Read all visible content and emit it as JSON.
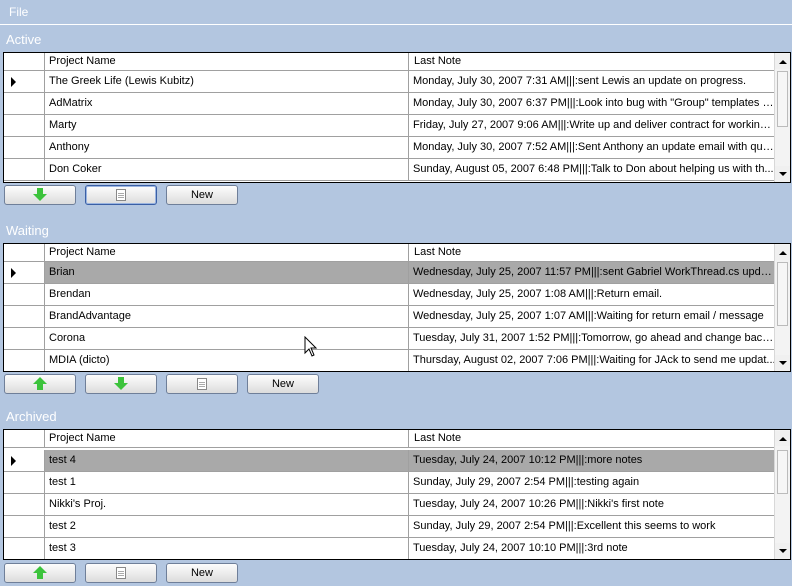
{
  "menu": {
    "file": "File"
  },
  "columns": {
    "name": "Project Name",
    "note": "Last Note"
  },
  "sections": [
    {
      "title": "Active",
      "rows": [
        {
          "name": "The Greek Life (Lewis Kubitz)",
          "note": "Monday, July 30, 2007 7:31 AM|||:sent Lewis an update on progress."
        },
        {
          "name": "AdMatrix",
          "note": "Monday, July 30, 2007 6:37 PM|||:Look into bug with \"Group\" templates o..."
        },
        {
          "name": "Marty",
          "note": "Friday, July 27, 2007 9:06 AM|||:Write up and deliver contract for working ..."
        },
        {
          "name": "Anthony",
          "note": "Monday, July 30, 2007 7:52 AM|||:Sent Anthony an update email with que..."
        },
        {
          "name": "Don Coker",
          "note": "Sunday, August 05, 2007 6:48 PM|||:Talk to Don about helping us with th..."
        }
      ],
      "buttons": {
        "new": "New"
      }
    },
    {
      "title": "Waiting",
      "rows": [
        {
          "name": "Brian",
          "note": "Wednesday, July 25, 2007 11:57 PM|||:sent Gabriel WorkThread.cs updat..."
        },
        {
          "name": "Brendan",
          "note": "Wednesday, July 25, 2007 1:08 AM|||:Return email."
        },
        {
          "name": "BrandAdvantage",
          "note": "Wednesday, July 25, 2007 1:07 AM|||:Waiting for return email / message"
        },
        {
          "name": "Corona",
          "note": "Tuesday, July 31, 2007 1:52 PM|||:Tomorrow, go ahead and change back..."
        },
        {
          "name": "MDIA (dicto)",
          "note": "Thursday, August 02, 2007 7:06 PM|||:Waiting for JAck to send me updat..."
        }
      ],
      "buttons": {
        "new": "New"
      }
    },
    {
      "title": "Archived",
      "rows": [
        {
          "name": "test 4",
          "note": "Tuesday, July 24, 2007 10:12 PM|||:more notes"
        },
        {
          "name": "test 1",
          "note": "Sunday, July 29, 2007 2:54 PM|||:testing again"
        },
        {
          "name": "Nikki's Proj.",
          "note": "Tuesday, July 24, 2007 10:26 PM|||:Nikki's first note"
        },
        {
          "name": "test 2",
          "note": "Sunday, July 29, 2007 2:54 PM|||:Excellent this seems to work"
        },
        {
          "name": "test 3",
          "note": "Tuesday, July 24, 2007 10:10 PM|||:3rd note"
        }
      ],
      "buttons": {
        "new": "New"
      }
    }
  ]
}
